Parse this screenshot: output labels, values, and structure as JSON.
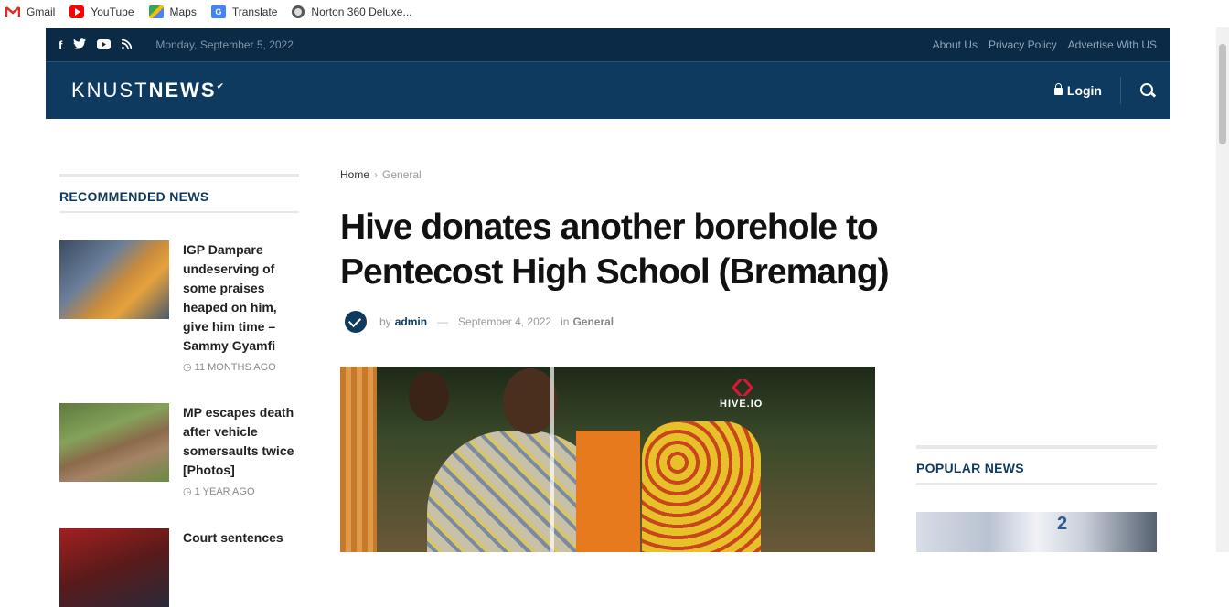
{
  "bookmarks": [
    {
      "label": "Gmail",
      "icon": "gmail-icon"
    },
    {
      "label": "YouTube",
      "icon": "youtube-icon"
    },
    {
      "label": "Maps",
      "icon": "maps-icon"
    },
    {
      "label": "Translate",
      "icon": "translate-icon"
    },
    {
      "label": "Norton 360 Deluxe...",
      "icon": "norton-icon"
    }
  ],
  "topbar": {
    "date": "Monday, September 5, 2022",
    "links": [
      "About Us",
      "Privacy Policy",
      "Advertise With US"
    ]
  },
  "header": {
    "logo_light": "KNUST",
    "logo_bold": "NEWS",
    "login": "Login"
  },
  "breadcrumb": {
    "home": "Home",
    "separator": "›",
    "current": "General"
  },
  "article": {
    "title": "Hive donates another borehole to Pentecost High School (Bremang)",
    "by": "by",
    "author": "admin",
    "date": "September 4, 2022",
    "in": "in",
    "category": "General",
    "image_brand": "HIVE.IO"
  },
  "recommended": {
    "title": "RECOMMENDED NEWS",
    "items": [
      {
        "title": "IGP Dampare undeserving of some praises heaped on him, give him time – Sammy Gyamfi",
        "time": "11 MONTHS AGO"
      },
      {
        "title": "MP escapes death after vehicle somersaults twice [Photos]",
        "time": "1 YEAR AGO"
      },
      {
        "title": "Court sentences",
        "time": ""
      }
    ]
  },
  "popular": {
    "title": "POPULAR NEWS",
    "image_text": "2"
  },
  "colors": {
    "navy": "#0b2a46",
    "header": "#0e3a60",
    "hive_red": "#e31337"
  }
}
